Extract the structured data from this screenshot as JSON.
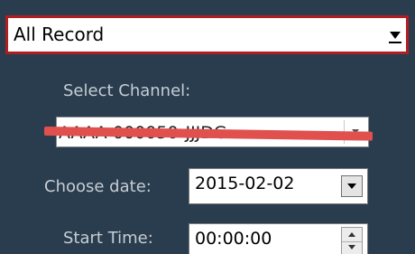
{
  "record_type": {
    "selected": "All Record",
    "icon": "dropdown-arrow-icon"
  },
  "channel": {
    "label": "Select Channel:",
    "value": "AAAA-000050-JJJDG",
    "icon": "dropdown-arrow-icon",
    "redaction_color": "#e0514e"
  },
  "date": {
    "label": "Choose date:",
    "value": "2015-02-02",
    "icon": "dropdown-arrow-icon"
  },
  "start_time": {
    "label": "Start Time:",
    "value": "00:00:00",
    "icons": [
      "spin-up-icon",
      "spin-down-icon"
    ]
  },
  "colors": {
    "panel_background": "#2a3d4e",
    "highlight_border": "#b01e24",
    "label_text": "#c7cdd3"
  }
}
